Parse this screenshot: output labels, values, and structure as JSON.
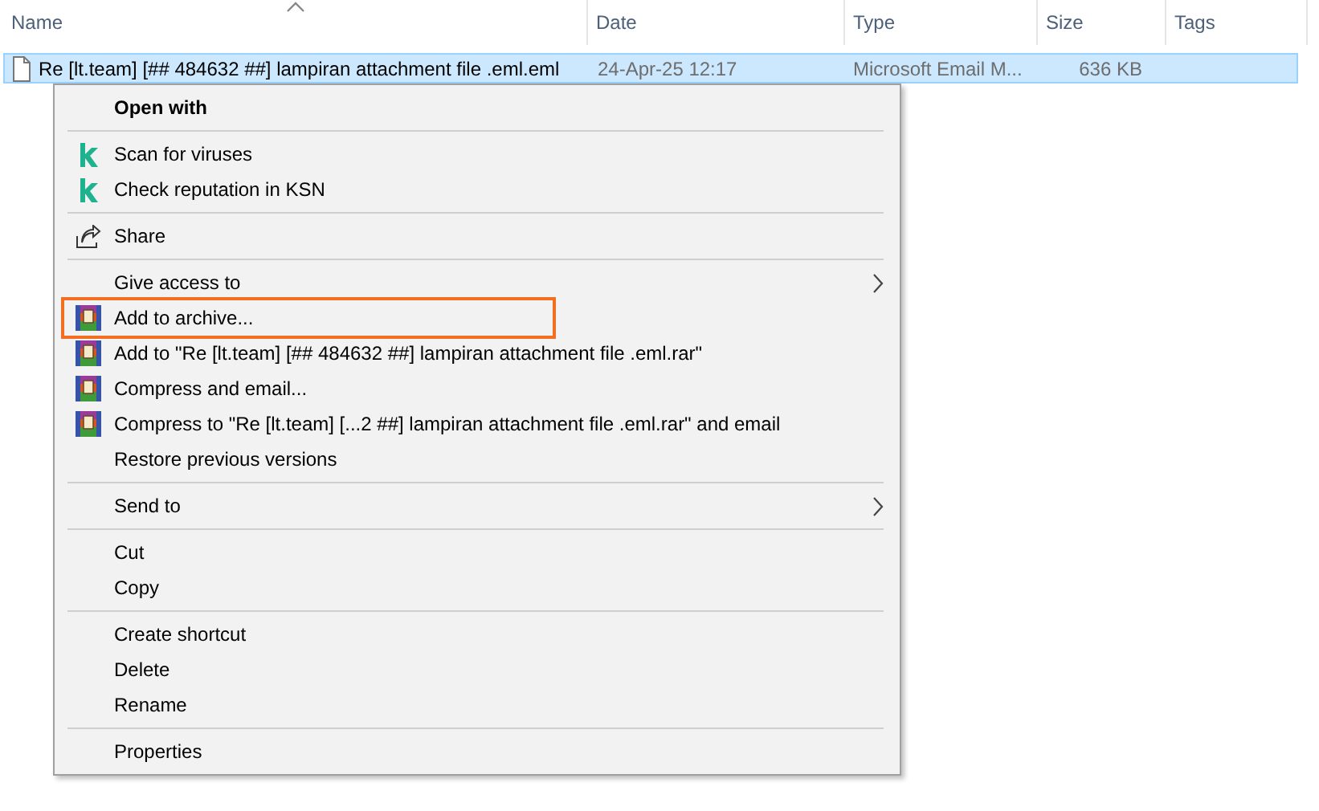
{
  "columns": [
    {
      "label": "Name",
      "sorted": true
    },
    {
      "label": "Date",
      "sorted": false
    },
    {
      "label": "Type",
      "sorted": false
    },
    {
      "label": "Size",
      "sorted": false
    },
    {
      "label": "Tags",
      "sorted": false
    }
  ],
  "rows": [
    {
      "selected": true,
      "cells": [
        "Re [lt.team] [## 484632 ##] lampiran attachment file .eml.eml",
        "24-Apr-25 12:17",
        "Microsoft Email M...",
        "636 KB"
      ]
    }
  ],
  "context_menu": {
    "items": [
      {
        "kind": "plain",
        "label": "Open with",
        "bold": true,
        "submenu": false,
        "highlighted": false
      },
      {
        "kind": "separator"
      },
      {
        "kind": "kaspersky",
        "label": "Scan for viruses",
        "bold": false,
        "submenu": false,
        "highlighted": false
      },
      {
        "kind": "kaspersky",
        "label": "Check reputation in KSN",
        "bold": false,
        "submenu": false,
        "highlighted": false
      },
      {
        "kind": "separator"
      },
      {
        "kind": "share",
        "label": "Share",
        "bold": false,
        "submenu": false,
        "highlighted": false
      },
      {
        "kind": "separator"
      },
      {
        "kind": "plain",
        "label": "Give access to",
        "bold": false,
        "submenu": true,
        "highlighted": false
      },
      {
        "kind": "archive",
        "label": "Add to archive...",
        "bold": false,
        "submenu": false,
        "highlighted": true
      },
      {
        "kind": "archive",
        "label": "Add to \"Re [lt.team] [## 484632 ##] lampiran attachment file .eml.rar\"",
        "bold": false,
        "submenu": false,
        "highlighted": false
      },
      {
        "kind": "archive",
        "label": "Compress and email...",
        "bold": false,
        "submenu": false,
        "highlighted": false
      },
      {
        "kind": "archive",
        "label": "Compress to \"Re [lt.team] [...2 ##] lampiran attachment file .eml.rar\" and email",
        "bold": false,
        "submenu": false,
        "highlighted": false
      },
      {
        "kind": "plain",
        "label": "Restore previous versions",
        "bold": false,
        "submenu": false,
        "highlighted": false
      },
      {
        "kind": "separator"
      },
      {
        "kind": "plain",
        "label": "Send to",
        "bold": false,
        "submenu": true,
        "highlighted": false
      },
      {
        "kind": "separator"
      },
      {
        "kind": "plain",
        "label": "Cut",
        "bold": false,
        "submenu": false,
        "highlighted": false
      },
      {
        "kind": "plain",
        "label": "Copy",
        "bold": false,
        "submenu": false,
        "highlighted": false
      },
      {
        "kind": "separator"
      },
      {
        "kind": "plain",
        "label": "Create shortcut",
        "bold": false,
        "submenu": false,
        "highlighted": false
      },
      {
        "kind": "plain",
        "label": "Delete",
        "bold": false,
        "submenu": false,
        "highlighted": false
      },
      {
        "kind": "plain",
        "label": "Rename",
        "bold": false,
        "submenu": false,
        "highlighted": false
      },
      {
        "kind": "separator"
      },
      {
        "kind": "plain",
        "label": "Properties",
        "bold": false,
        "submenu": false,
        "highlighted": false
      }
    ]
  }
}
